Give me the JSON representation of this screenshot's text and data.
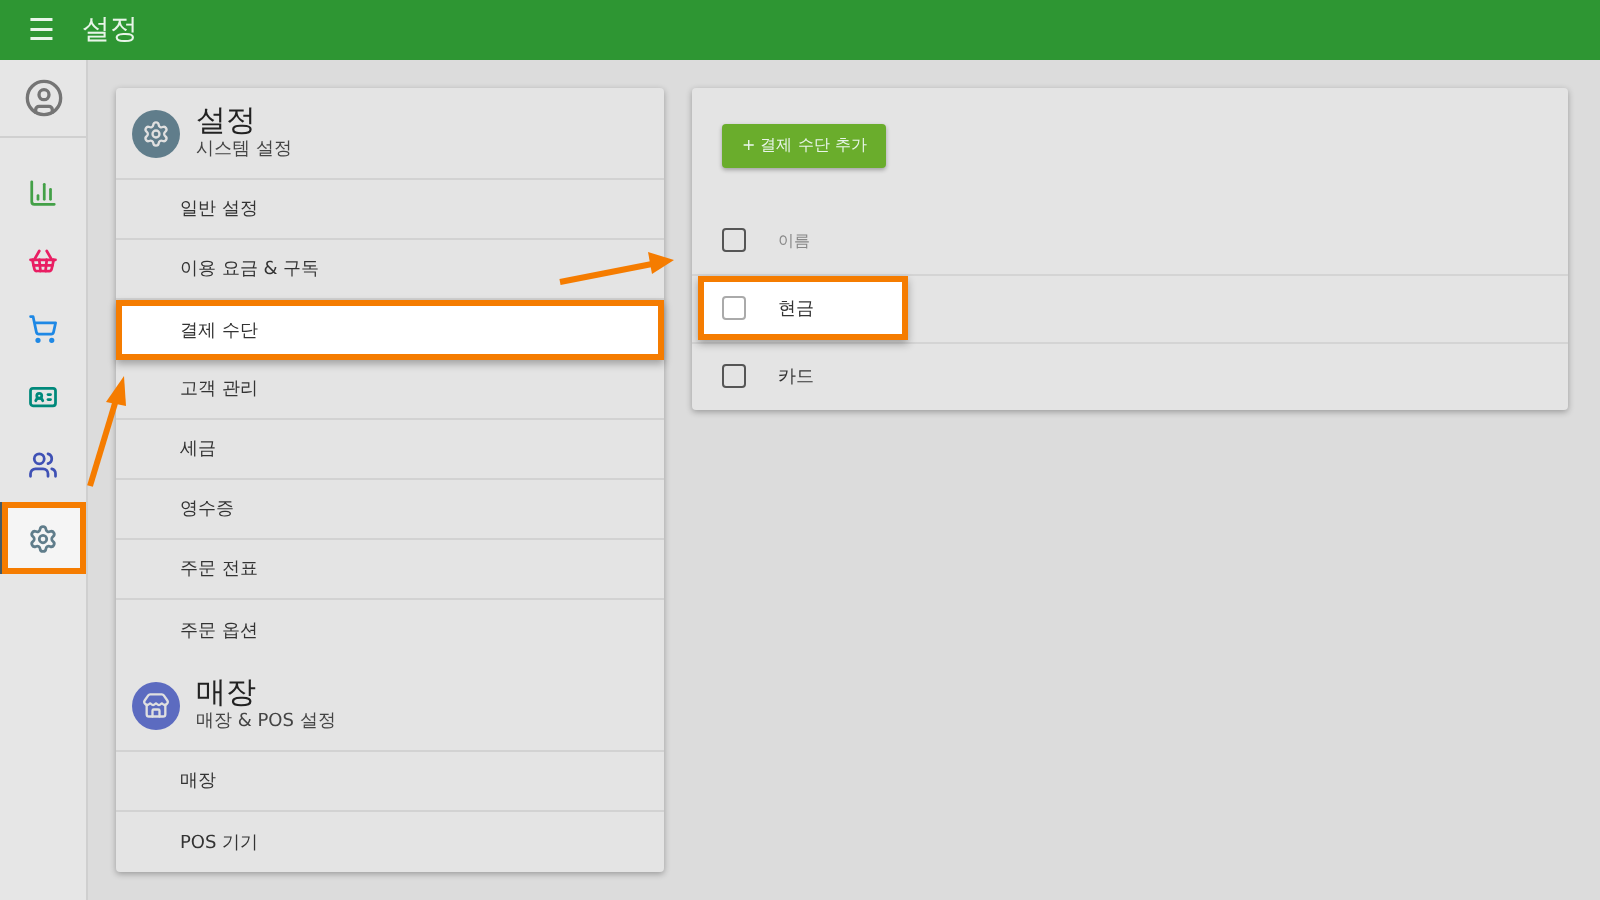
{
  "app_bar": {
    "menu_icon": "☰",
    "title": "설정"
  },
  "rail": [
    {
      "kind": "account",
      "color": "#757575",
      "selected": false,
      "highlighted": false
    },
    {
      "kind": "chart",
      "color": "#43a047",
      "selected": false,
      "highlighted": false
    },
    {
      "kind": "basket",
      "color": "#e91e63",
      "selected": false,
      "highlighted": false
    },
    {
      "kind": "cart",
      "color": "#1e88e5",
      "selected": false,
      "highlighted": false
    },
    {
      "kind": "card",
      "color": "#00897b",
      "selected": false,
      "highlighted": false
    },
    {
      "kind": "people",
      "color": "#3f51b5",
      "selected": false,
      "highlighted": false
    },
    {
      "kind": "settings",
      "color": "#607d8b",
      "selected": true,
      "highlighted": true
    }
  ],
  "sections": [
    {
      "kind": "settings",
      "title": "설정",
      "subtitle": "시스템 설정",
      "items": [
        {
          "label": "일반 설정",
          "selected": false,
          "highlighted": false
        },
        {
          "label": "이용 요금 & 구독",
          "selected": false,
          "highlighted": false
        },
        {
          "label": "결제 수단",
          "selected": true,
          "highlighted": true
        },
        {
          "label": "고객 관리",
          "selected": false,
          "highlighted": false
        },
        {
          "label": "세금",
          "selected": false,
          "highlighted": false
        },
        {
          "label": "영수증",
          "selected": false,
          "highlighted": false
        },
        {
          "label": "주문 전표",
          "selected": false,
          "highlighted": false
        },
        {
          "label": "주문 옵션",
          "selected": false,
          "highlighted": false
        }
      ]
    },
    {
      "kind": "store",
      "title": "매장",
      "subtitle": "매장 & POS 설정",
      "items": [
        {
          "label": "매장",
          "selected": false,
          "highlighted": false
        },
        {
          "label": "POS 기기",
          "selected": false,
          "highlighted": false
        }
      ]
    }
  ],
  "payment_panel": {
    "add_button": "+ 결제 수단 추가",
    "header": {
      "label": "이름",
      "checked": false
    },
    "rows": [
      {
        "label": "현금",
        "checked": false,
        "highlighted": true
      },
      {
        "label": "카드",
        "checked": false,
        "highlighted": false
      }
    ]
  }
}
